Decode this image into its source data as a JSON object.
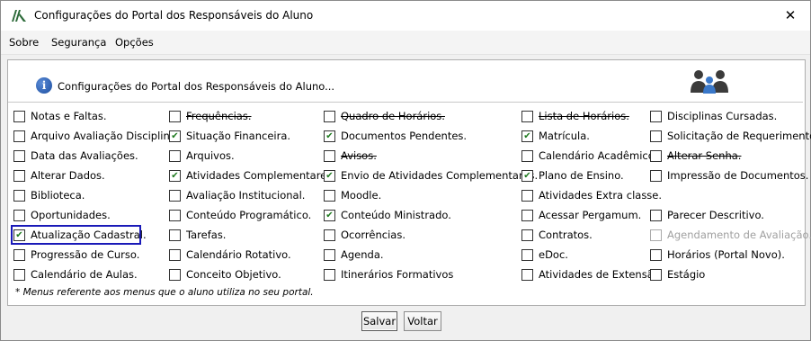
{
  "window": {
    "title": "Configurações do Portal dos Responsáveis do Aluno",
    "close_glyph": "✕"
  },
  "menu": [
    "Sobre",
    "Segurança",
    "Opções"
  ],
  "header": {
    "text": "Configurações do Portal dos Responsáveis do Aluno...",
    "info_glyph": "i"
  },
  "checkbox_glyph": "✔",
  "columns": [
    [
      {
        "label": "Notas e Faltas.",
        "checked": false,
        "strike": false,
        "disabled": false
      },
      {
        "label": "Arquivo Avaliação Disciplina.",
        "checked": false,
        "strike": false,
        "disabled": false
      },
      {
        "label": "Data das Avaliações.",
        "checked": false,
        "strike": false,
        "disabled": false
      },
      {
        "label": "Alterar Dados.",
        "checked": false,
        "strike": false,
        "disabled": false
      },
      {
        "label": "Biblioteca.",
        "checked": false,
        "strike": false,
        "disabled": false
      },
      {
        "label": "Oportunidades.",
        "checked": false,
        "strike": false,
        "disabled": false
      },
      {
        "label": "Atualização Cadastral.",
        "checked": true,
        "strike": false,
        "disabled": false
      },
      {
        "label": "Progressão de Curso.",
        "checked": false,
        "strike": false,
        "disabled": false
      },
      {
        "label": "Calendário de Aulas.",
        "checked": false,
        "strike": false,
        "disabled": false
      }
    ],
    [
      {
        "label": "Frequências.",
        "checked": false,
        "strike": true,
        "disabled": false
      },
      {
        "label": "Situação Financeira.",
        "checked": true,
        "strike": false,
        "disabled": false
      },
      {
        "label": "Arquivos.",
        "checked": false,
        "strike": false,
        "disabled": false
      },
      {
        "label": "Atividades Complementares.",
        "checked": true,
        "strike": false,
        "disabled": false
      },
      {
        "label": "Avaliação Institucional.",
        "checked": false,
        "strike": false,
        "disabled": false
      },
      {
        "label": "Conteúdo Programático.",
        "checked": false,
        "strike": false,
        "disabled": false
      },
      {
        "label": "Tarefas.",
        "checked": false,
        "strike": false,
        "disabled": false
      },
      {
        "label": "Calendário Rotativo.",
        "checked": false,
        "strike": false,
        "disabled": false
      },
      {
        "label": "Conceito Objetivo.",
        "checked": false,
        "strike": false,
        "disabled": false
      }
    ],
    [
      {
        "label": "Quadro de Horários.",
        "checked": false,
        "strike": true,
        "disabled": false
      },
      {
        "label": "Documentos Pendentes.",
        "checked": true,
        "strike": false,
        "disabled": false
      },
      {
        "label": "Avisos.",
        "checked": false,
        "strike": true,
        "disabled": false
      },
      {
        "label": "Envio de Atividades Complementares.",
        "checked": true,
        "strike": false,
        "disabled": false
      },
      {
        "label": "Moodle.",
        "checked": false,
        "strike": false,
        "disabled": false
      },
      {
        "label": "Conteúdo Ministrado.",
        "checked": true,
        "strike": false,
        "disabled": false
      },
      {
        "label": "Ocorrências.",
        "checked": false,
        "strike": false,
        "disabled": false
      },
      {
        "label": "Agenda.",
        "checked": false,
        "strike": false,
        "disabled": false
      },
      {
        "label": "Itinerários Formativos",
        "checked": false,
        "strike": false,
        "disabled": false
      }
    ],
    [
      {
        "label": "Lista de Horários.",
        "checked": false,
        "strike": true,
        "disabled": false
      },
      {
        "label": "Matrícula.",
        "checked": true,
        "strike": false,
        "disabled": false
      },
      {
        "label": "Calendário Acadêmico.",
        "checked": false,
        "strike": false,
        "disabled": false
      },
      {
        "label": "Plano de Ensino.",
        "checked": true,
        "strike": false,
        "disabled": false
      },
      {
        "label": "Atividades Extra classe.",
        "checked": false,
        "strike": false,
        "disabled": false
      },
      {
        "label": "Acessar Pergamum.",
        "checked": false,
        "strike": false,
        "disabled": false
      },
      {
        "label": "Contratos.",
        "checked": false,
        "strike": false,
        "disabled": false
      },
      {
        "label": "eDoc.",
        "checked": false,
        "strike": false,
        "disabled": false
      },
      {
        "label": "Atividades de Extensão",
        "checked": false,
        "strike": false,
        "disabled": false
      }
    ],
    [
      {
        "label": "Disciplinas Cursadas.",
        "checked": false,
        "strike": false,
        "disabled": false
      },
      {
        "label": "Solicitação de Requerimento.",
        "checked": false,
        "strike": false,
        "disabled": false
      },
      {
        "label": "Alterar Senha.",
        "checked": false,
        "strike": true,
        "disabled": false
      },
      {
        "label": "Impressão de Documentos.",
        "checked": false,
        "strike": false,
        "disabled": false
      },
      {
        "label": "",
        "checked": false,
        "strike": false,
        "disabled": false,
        "hidden": true
      },
      {
        "label": "Parecer Descritivo.",
        "checked": false,
        "strike": false,
        "disabled": false
      },
      {
        "label": "Agendamento de Avaliação.",
        "checked": false,
        "strike": false,
        "disabled": true
      },
      {
        "label": "Horários (Portal Novo).",
        "checked": false,
        "strike": false,
        "disabled": false
      },
      {
        "label": "Estágio",
        "checked": false,
        "strike": false,
        "disabled": false
      }
    ]
  ],
  "note": "* Menus referente aos menus que o aluno utiliza no seu portal.",
  "buttons": {
    "save": "Salvar",
    "back": "Voltar"
  }
}
